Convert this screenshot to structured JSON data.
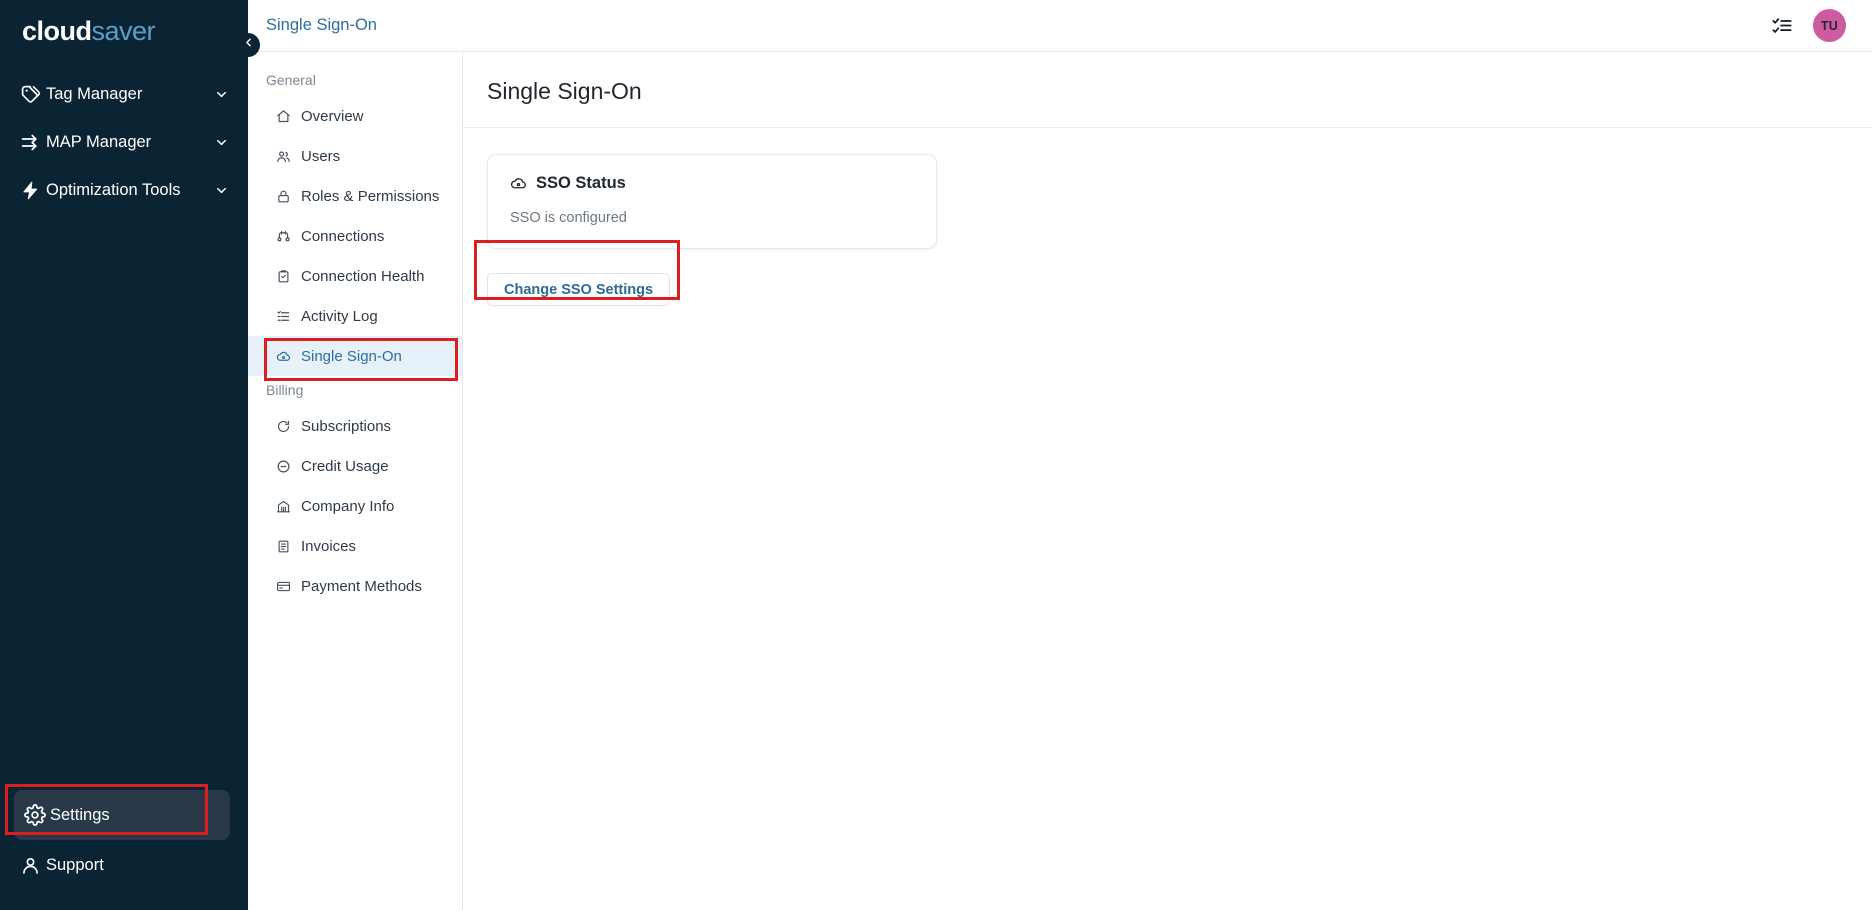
{
  "brand": {
    "first": "cloud",
    "second": "saver"
  },
  "primary_nav": {
    "top_items": [
      {
        "label": "Tag Manager",
        "icon": "tags-icon",
        "chevron": "chevron-down-icon"
      },
      {
        "label": "MAP Manager",
        "icon": "arrows-exchange-icon",
        "chevron": "chevron-down-icon"
      },
      {
        "label": "Optimization Tools",
        "icon": "lightning-bolt-icon",
        "chevron": "chevron-down-icon"
      }
    ],
    "bottom_items": [
      {
        "label": "Settings",
        "icon": "gear-icon",
        "active": true
      },
      {
        "label": "Support",
        "icon": "user-headset-icon",
        "active": false
      }
    ],
    "collapse": {
      "icon": "chevron-left-icon"
    }
  },
  "topbar": {
    "breadcrumb": "Single Sign-On",
    "tasks_icon": "checklist-icon",
    "avatar_initials": "TU",
    "avatar_color": "#cc5ba0"
  },
  "secondary_nav": {
    "groups": [
      {
        "title": "General",
        "items": [
          {
            "label": "Overview",
            "icon": "home-icon",
            "selected": false
          },
          {
            "label": "Users",
            "icon": "users-icon",
            "selected": false
          },
          {
            "label": "Roles & Permissions",
            "icon": "lock-icon",
            "selected": false
          },
          {
            "label": "Connections",
            "icon": "connections-icon",
            "selected": false
          },
          {
            "label": "Connection Health",
            "icon": "clipboard-check-icon",
            "selected": false
          },
          {
            "label": "Activity Log",
            "icon": "list-icon",
            "selected": false
          },
          {
            "label": "Single Sign-On",
            "icon": "cloud-key-icon",
            "selected": true
          }
        ]
      },
      {
        "title": "Billing",
        "items": [
          {
            "label": "Subscriptions",
            "icon": "refresh-circle-icon",
            "selected": false
          },
          {
            "label": "Credit Usage",
            "icon": "circle-minus-icon",
            "selected": false
          },
          {
            "label": "Company Info",
            "icon": "building-icon",
            "selected": false
          },
          {
            "label": "Invoices",
            "icon": "invoice-icon",
            "selected": false
          },
          {
            "label": "Payment Methods",
            "icon": "credit-card-icon",
            "selected": false
          }
        ]
      }
    ]
  },
  "main": {
    "page_title": "Single Sign-On",
    "card": {
      "icon": "cloud-key-icon",
      "title": "SSO Status",
      "status_text": "SSO is configured"
    },
    "change_button": "Change SSO Settings"
  },
  "annotations": {
    "color": "#d91f1f",
    "boxes": [
      "settings-sidebar-item",
      "single-sign-on-nav-item",
      "change-sso-settings-button"
    ]
  }
}
